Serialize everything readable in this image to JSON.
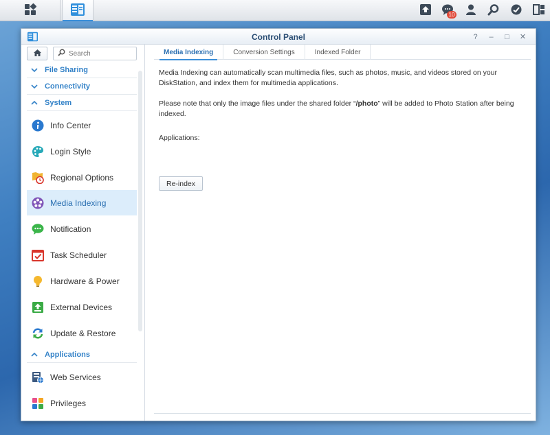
{
  "taskbar": {
    "main_menu_icon": "grid-icon",
    "app_icon": "control-panel-icon",
    "notifications_count": "10",
    "right_icons": [
      "upload-icon",
      "notifications-icon",
      "user-icon",
      "search-icon",
      "widgets-icon",
      "windows-icon"
    ]
  },
  "window": {
    "title": "Control Panel",
    "controls": [
      "?",
      "–",
      "□",
      "✕"
    ]
  },
  "sidebar": {
    "search_placeholder": "Search",
    "categories": {
      "file_sharing": "File Sharing",
      "connectivity": "Connectivity",
      "system": "System",
      "applications": "Applications"
    },
    "items": [
      {
        "label": "Info Center",
        "icon": "info-icon"
      },
      {
        "label": "Login Style",
        "icon": "palette-icon"
      },
      {
        "label": "Regional Options",
        "icon": "clock-map-icon"
      },
      {
        "label": "Media Indexing",
        "icon": "film-reel-icon",
        "active": true
      },
      {
        "label": "Notification",
        "icon": "chat-bubble-icon"
      },
      {
        "label": "Task Scheduler",
        "icon": "calendar-check-icon"
      },
      {
        "label": "Hardware & Power",
        "icon": "lightbulb-icon"
      },
      {
        "label": "External Devices",
        "icon": "external-device-icon"
      },
      {
        "label": "Update & Restore",
        "icon": "refresh-icon"
      }
    ],
    "app_items": [
      {
        "label": "Web Services",
        "icon": "web-services-icon"
      },
      {
        "label": "Privileges",
        "icon": "privileges-icon"
      }
    ]
  },
  "content": {
    "tabs": [
      "Media Indexing",
      "Conversion Settings",
      "Indexed Folder"
    ],
    "paragraph1": "Media Indexing can automatically scan multimedia files, such as photos, music, and videos stored on your DiskStation, and index them for multimedia applications.",
    "paragraph2_a": "Please note that only the image files under the shared folder “",
    "paragraph2_folder": "/photo",
    "paragraph2_b": "” will be added to Photo Station after being indexed.",
    "applications_label": "Applications:",
    "reindex_button": "Re-index"
  },
  "colors": {
    "accent": "#3b8fd9",
    "active_bg": "#dcedfb",
    "category_text": "#3583c8"
  }
}
